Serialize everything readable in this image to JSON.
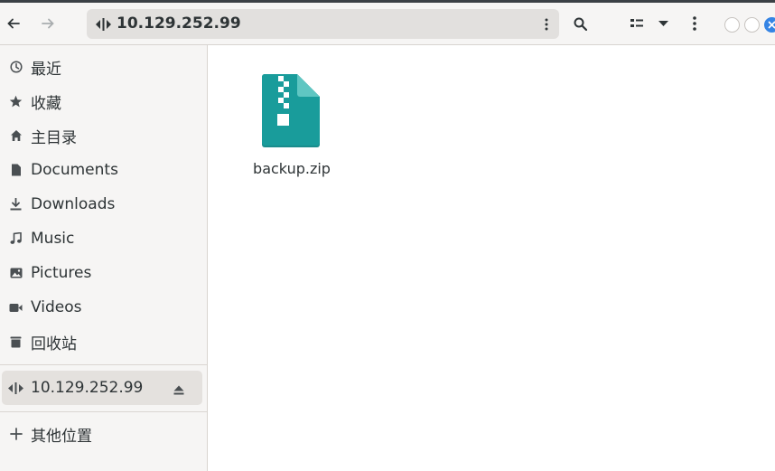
{
  "header": {
    "path_label": "10.129.252.99",
    "back_icon": "arrow-left-icon",
    "forward_icon": "arrow-right-icon",
    "search_icon": "search-icon",
    "view_icon": "list-view-icon",
    "menu_icon": "kebab-menu-icon"
  },
  "sidebar": {
    "items": [
      {
        "label": "最近",
        "icon": "clock-icon"
      },
      {
        "label": "收藏",
        "icon": "star-icon"
      },
      {
        "label": "主目录",
        "icon": "home-icon"
      },
      {
        "label": "Documents",
        "icon": "document-icon"
      },
      {
        "label": "Downloads",
        "icon": "download-icon"
      },
      {
        "label": "Music",
        "icon": "music-icon"
      },
      {
        "label": "Pictures",
        "icon": "picture-icon"
      },
      {
        "label": "Videos",
        "icon": "video-icon"
      },
      {
        "label": "回收站",
        "icon": "trash-icon"
      }
    ],
    "network": {
      "label": "10.129.252.99",
      "icon": "network-icon"
    },
    "other": {
      "label": "其他位置",
      "icon": "plus-icon"
    }
  },
  "content": {
    "files": [
      {
        "name": "backup.zip",
        "icon": "zip-archive-icon"
      }
    ]
  },
  "colors": {
    "accent": "#3584e4",
    "archive": "#199c9b"
  }
}
